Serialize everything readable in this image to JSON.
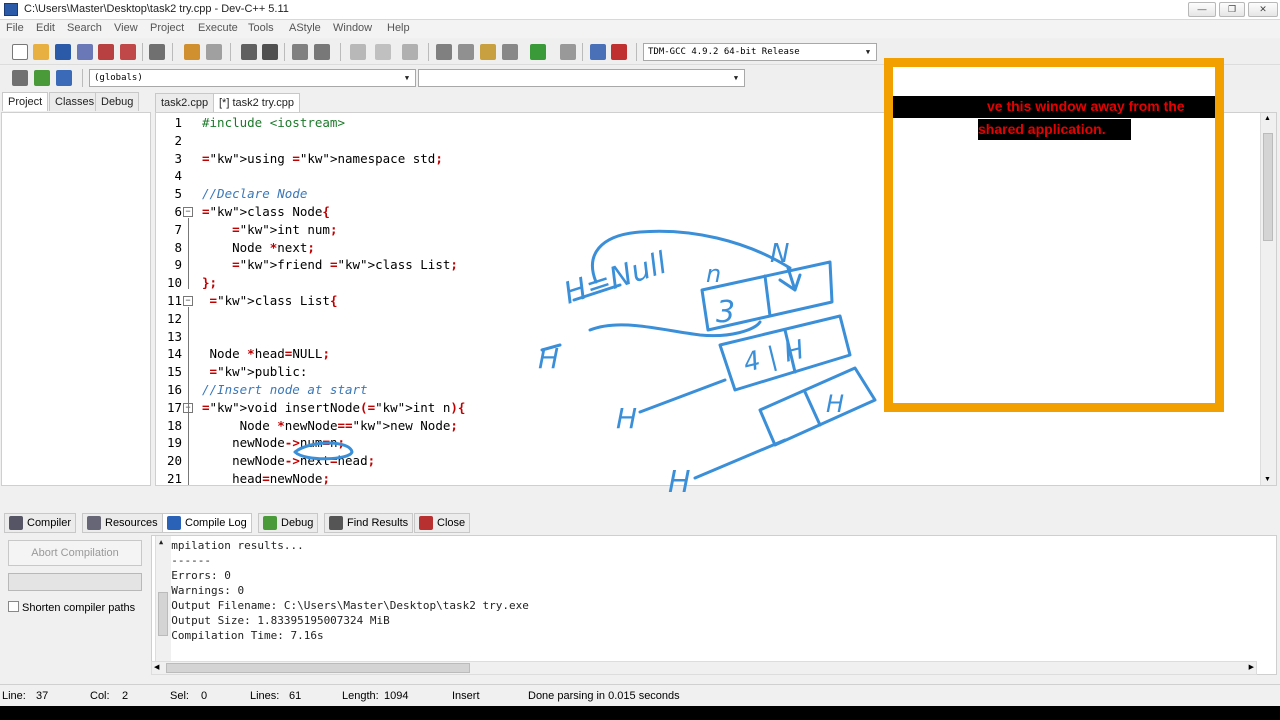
{
  "window": {
    "title": "C:\\Users\\Master\\Desktop\\task2 try.cpp - Dev-C++ 5.11"
  },
  "menu": [
    "File",
    "Edit",
    "Search",
    "View",
    "Project",
    "Execute",
    "Tools",
    "AStyle",
    "Window",
    "Help"
  ],
  "toolbar": {
    "compiler_select": "TDM-GCC 4.9.2 64-bit Release",
    "scope_select": "(globals)",
    "member_select": ""
  },
  "left_tabs": [
    "Project",
    "Classes",
    "Debug"
  ],
  "editor_tabs": [
    "task2.cpp",
    "[*] task2 try.cpp"
  ],
  "code_lines": [
    {
      "n": "1",
      "t": "#include <iostream>"
    },
    {
      "n": "2",
      "t": ""
    },
    {
      "n": "3",
      "t": "using namespace std;"
    },
    {
      "n": "4",
      "t": ""
    },
    {
      "n": "5",
      "t": "//Declare Node"
    },
    {
      "n": "6",
      "t": "class Node{"
    },
    {
      "n": "7",
      "t": "    int num;"
    },
    {
      "n": "8",
      "t": "    Node *next;"
    },
    {
      "n": "9",
      "t": "    friend class List;"
    },
    {
      "n": "10",
      "t": "};"
    },
    {
      "n": "11",
      "t": " class List{"
    },
    {
      "n": "12",
      "t": ""
    },
    {
      "n": "13",
      "t": ""
    },
    {
      "n": "14",
      "t": " Node *head=NULL;"
    },
    {
      "n": "15",
      "t": " public:"
    },
    {
      "n": "16",
      "t": "//Insert node at start"
    },
    {
      "n": "17",
      "t": "void insertNode(int n){"
    },
    {
      "n": "18",
      "t": "     Node *newNode=new Node;"
    },
    {
      "n": "19",
      "t": "    newNode->num=n;"
    },
    {
      "n": "20",
      "t": "    newNode->next=head;"
    },
    {
      "n": "21",
      "t": "    head=newNode;"
    }
  ],
  "overlay": {
    "message_line1": "ve this window away from the",
    "message_line2": "shared application."
  },
  "bottom_tabs": [
    "Compiler",
    "Resources",
    "Compile Log",
    "Debug",
    "Find Results",
    "Close"
  ],
  "compile_panel": {
    "abort_label": "Abort Compilation",
    "shorten_label": "Shorten compiler paths",
    "log": [
      "Compilation results...",
      "--------",
      "- Errors: 0",
      "- Warnings: 0",
      "- Output Filename: C:\\Users\\Master\\Desktop\\task2 try.exe",
      "- Output Size: 1.83395195007324 MiB",
      "- Compilation Time: 7.16s"
    ]
  },
  "status": {
    "line_label": "Line:",
    "line_value": "37",
    "col_label": "Col:",
    "col_value": "2",
    "sel_label": "Sel:",
    "sel_value": "0",
    "lines_label": "Lines:",
    "lines_value": "61",
    "length_label": "Length:",
    "length_value": "1094",
    "mode": "Insert",
    "message": "Done parsing in 0.015 seconds"
  },
  "annotations": {
    "h_null": "H=Null",
    "n_label": "n",
    "n_label2": "N",
    "box1": "3",
    "box2": "4 | H",
    "box3": "H",
    "h1": "H",
    "h2": "H",
    "h3": "H"
  },
  "colors": {
    "accent_overlay": "#f2a000",
    "ink": "#3a8fd8",
    "message_red": "#e60000"
  }
}
